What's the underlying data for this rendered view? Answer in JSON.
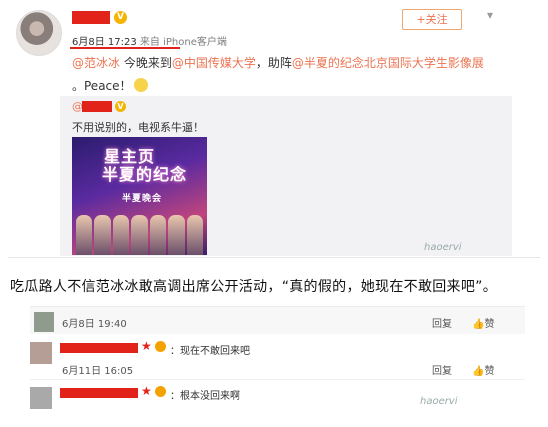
{
  "post": {
    "follow_label": "+关注",
    "chevron": "▾",
    "verified_badge": "V",
    "meta_time": "6月8日 17:23",
    "meta_source": "来自 iPhone客户端",
    "body_line1_prefix": "@范冰冰",
    "body_line1_mid": "今晚来到",
    "body_line1_link2": "@中国传媒大学",
    "body_line1_mid2": "，助阵",
    "body_line1_link3": "@半夏的纪念北京国际大学生影像展",
    "body_line2": "。Peace！",
    "repost_at": "@",
    "repost_text": "不用说别的，电视系牛逼！",
    "poster_title1": "星主页",
    "poster_title2": "半夏的纪念",
    "poster_sub": "半夏晚会",
    "watermark": "haoervi"
  },
  "caption": "吃瓜路人不信范冰冰敢高调出席公开活动，“真的假的，她现在不敢回来吧”。",
  "comments": [
    {
      "date": "6月8日 19:40",
      "reply": "回复",
      "like": "赞"
    },
    {
      "text": "：现在不敢回来吧",
      "date": "6月11日 16:05",
      "reply": "回复",
      "like": "赞"
    },
    {
      "text": "：根本没回来啊",
      "watermark": "haoervi"
    }
  ],
  "icons": [
    "avatar",
    "verified-icon",
    "star-icon",
    "level-icon",
    "like-icon",
    "chevron-down-icon"
  ],
  "colors": {
    "accent": "#eb7350",
    "redact": "#e2231a",
    "verified": "#f5b400"
  }
}
